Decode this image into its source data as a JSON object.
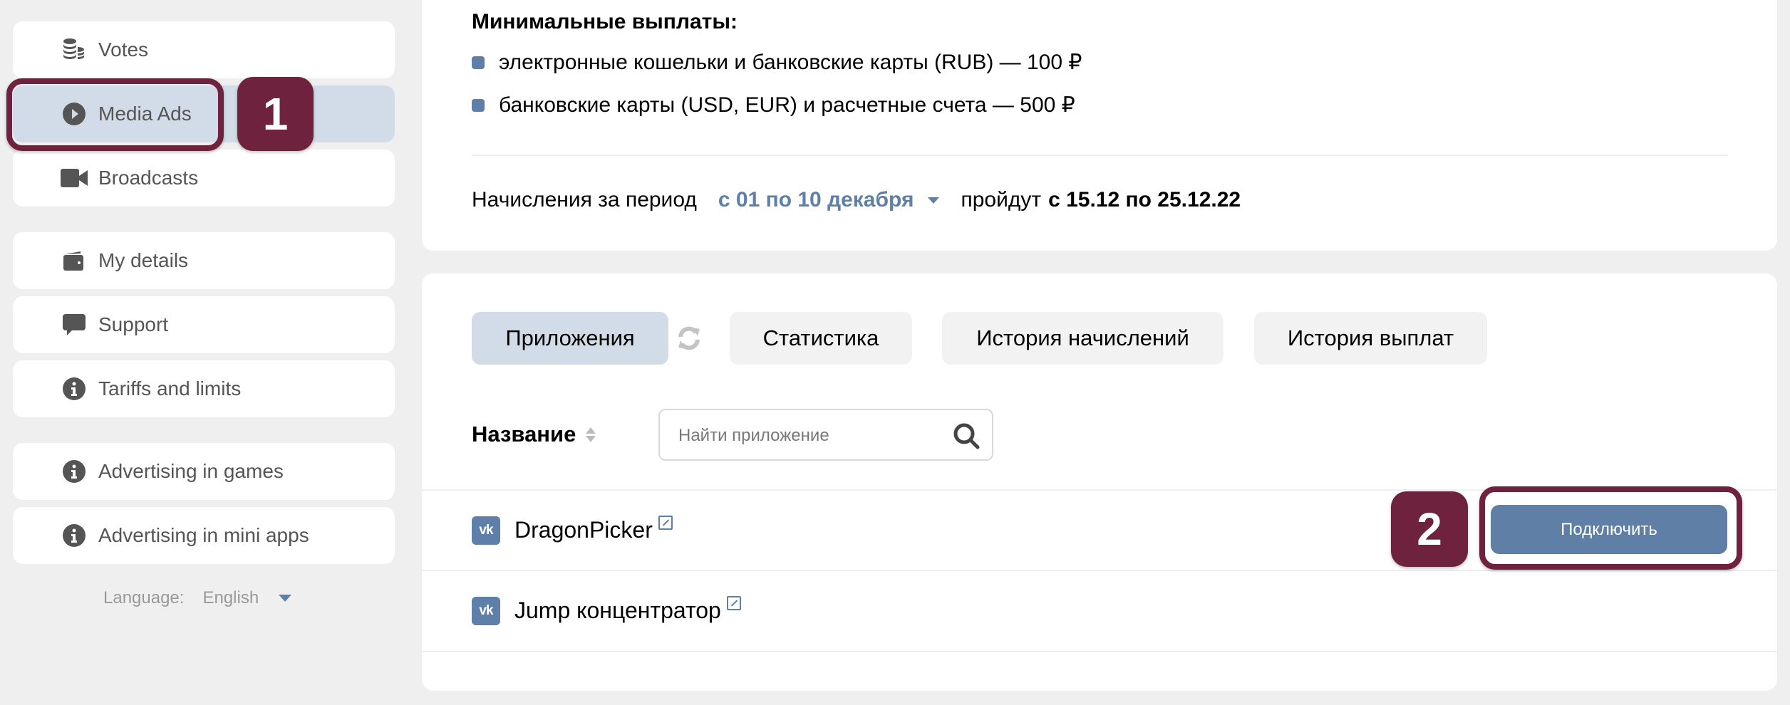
{
  "sidebar": {
    "items": [
      {
        "label": "Votes",
        "icon": "coins-icon",
        "active": false
      },
      {
        "label": "Media Ads",
        "icon": "play-circle-icon",
        "active": true
      },
      {
        "label": "Broadcasts",
        "icon": "video-camera-icon",
        "active": false
      },
      {
        "label": "My details",
        "icon": "wallet-icon",
        "active": false
      },
      {
        "label": "Support",
        "icon": "chat-bubble-icon",
        "active": false
      },
      {
        "label": "Tariffs and limits",
        "icon": "info-icon",
        "active": false
      },
      {
        "label": "Advertising in games",
        "icon": "info-icon",
        "active": false
      },
      {
        "label": "Advertising in mini apps",
        "icon": "info-icon",
        "active": false
      }
    ],
    "language": {
      "label": "Language:",
      "value": "English"
    }
  },
  "annotations": {
    "badge1": "1",
    "badge2": "2",
    "color": "#6f223d"
  },
  "payouts": {
    "title": "Минимальные выплаты:",
    "items": [
      "электронные кошельки и банковские карты (RUB) — 100 ₽",
      "банковские карты (USD, EUR) и расчетные счета — 500 ₽"
    ],
    "period_prefix": "Начисления за период",
    "period_value": "с 01 по 10 декабря",
    "period_middle": "пройдут",
    "period_dates": "с 15.12 по 25.12.22"
  },
  "tabs": [
    {
      "label": "Приложения",
      "active": true
    },
    {
      "label": "Статистика",
      "active": false
    },
    {
      "label": "История начислений",
      "active": false
    },
    {
      "label": "История выплат",
      "active": false
    }
  ],
  "apps_table": {
    "column_name": "Название",
    "search_placeholder": "Найти приложение",
    "search_value": "",
    "rows": [
      {
        "name": "DragonPicker",
        "platform_icon": "vk-icon",
        "action": "Подключить"
      },
      {
        "name": "Jump концентратор",
        "platform_icon": "vk-icon",
        "action": ""
      }
    ]
  },
  "colors": {
    "accent": "#5d7fa8",
    "active_bg": "#d1dce8",
    "page_bg": "#efefef"
  }
}
